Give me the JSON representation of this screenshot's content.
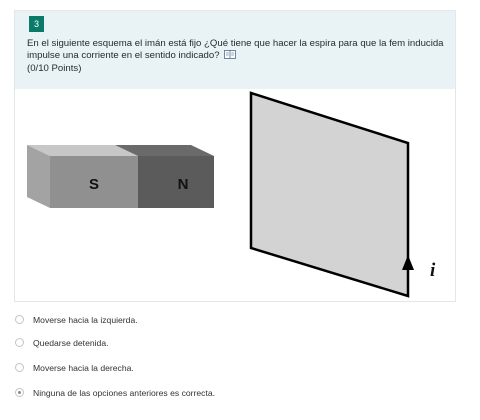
{
  "question": {
    "number": "3",
    "text": "En el siguiente esquema el imán está fijo ¿Qué tiene que hacer la espira para que la fem inducida impulse una corriente en el sentido indicado?",
    "points": "(0/10 Points)"
  },
  "figure": {
    "magnet_left_label": "S",
    "magnet_right_label": "N",
    "current_label": "i"
  },
  "options": [
    {
      "label": "Moverse hacia la izquierda.",
      "selected": false
    },
    {
      "label": "Quedarse detenida.",
      "selected": false
    },
    {
      "label": "Moverse hacia la derecha.",
      "selected": false
    },
    {
      "label": "Ninguna de las opciones anteriores es correcta.",
      "selected": true
    }
  ]
}
